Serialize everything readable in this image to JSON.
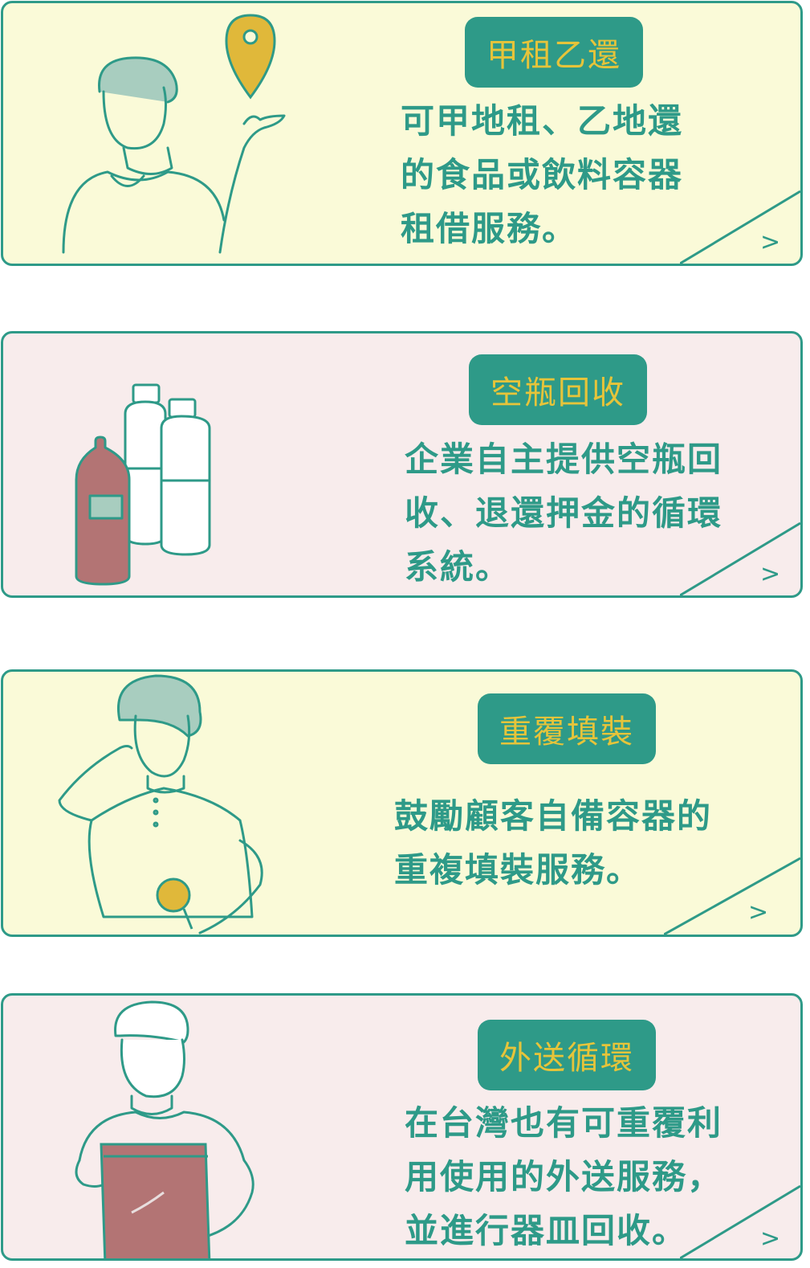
{
  "colors": {
    "teal": "#2e9a88",
    "gold": "#e6c43a",
    "card_yellow": "#fafad8",
    "card_pink": "#f8ecec",
    "brown": "#b37474"
  },
  "cards": [
    {
      "title": "甲租乙還",
      "description": "可甲地租、乙地還\n的食品或飲料容器\n租借服務。",
      "arrow": ">",
      "illustration": "person-with-location-pin"
    },
    {
      "title": "空瓶回收",
      "description": "企業自主提供空瓶回\n收、退還押金的循環\n系統。",
      "arrow": ">",
      "illustration": "bottles"
    },
    {
      "title": "重覆填裝",
      "description": "鼓勵顧客自備容器的\n重複填裝服務。",
      "arrow": ">",
      "illustration": "person-thinking"
    },
    {
      "title": "外送循環",
      "description": "在台灣也有可重覆利\n用使用的外送服務，\n並進行器皿回收。",
      "arrow": ">",
      "illustration": "delivery-person"
    }
  ]
}
